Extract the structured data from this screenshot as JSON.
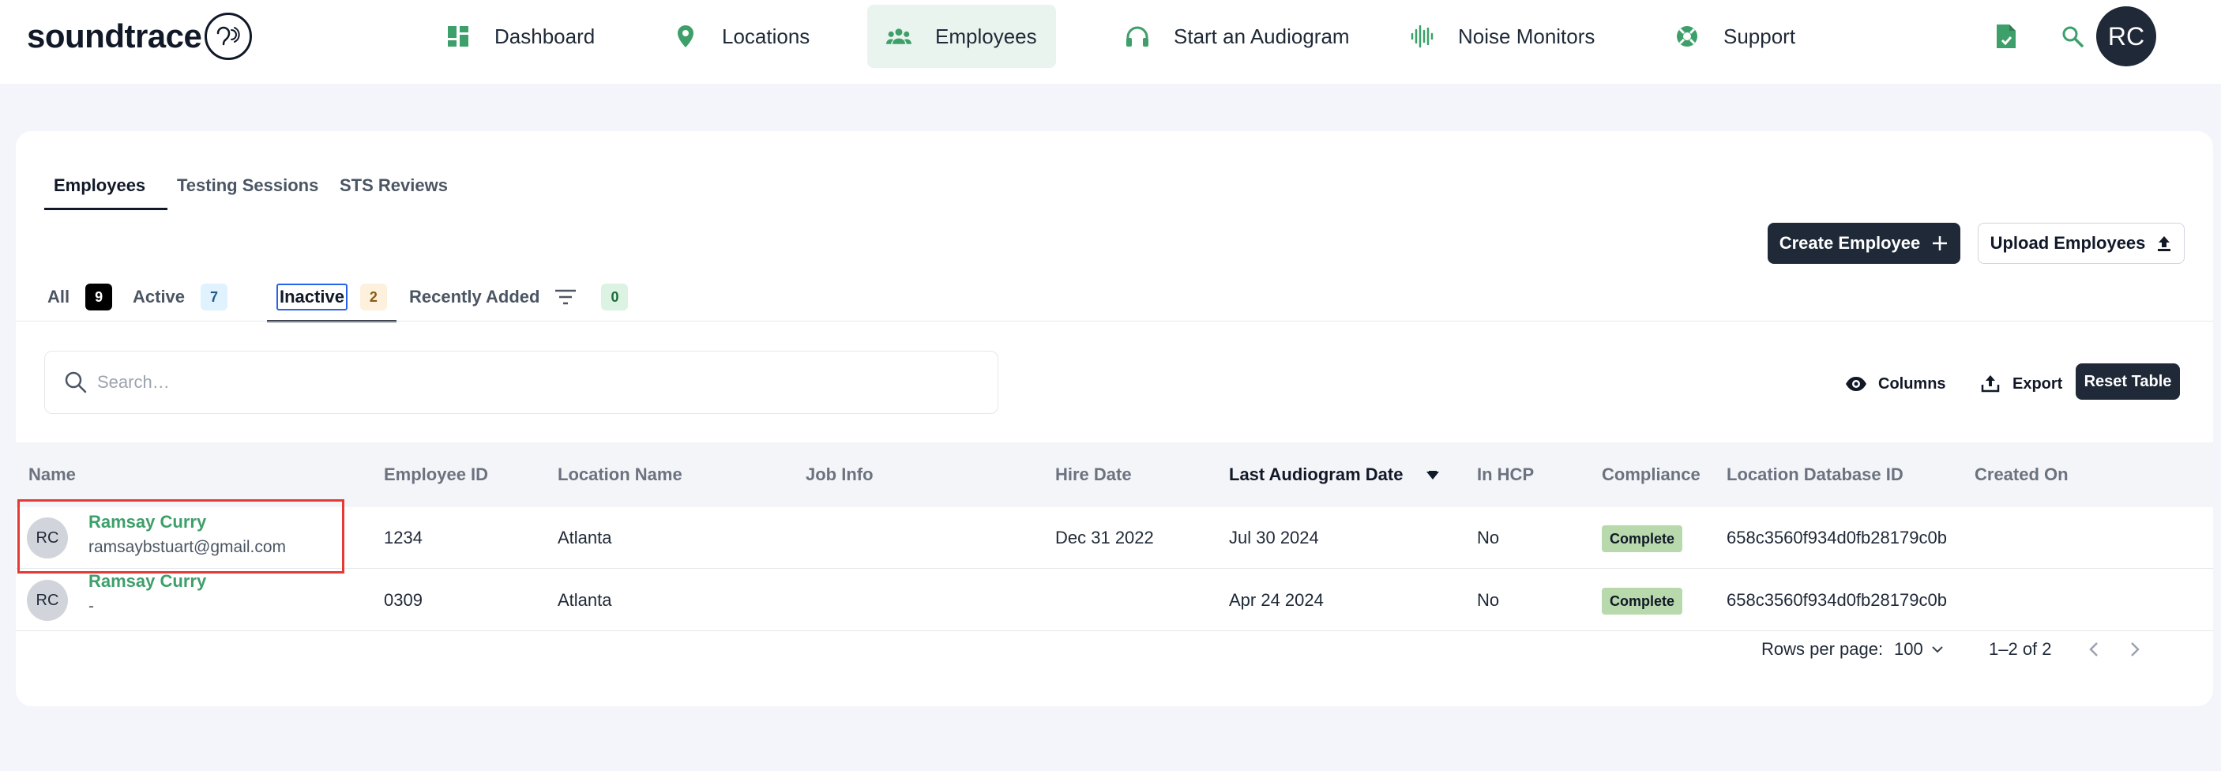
{
  "app": {
    "logo_text": "soundtrace"
  },
  "nav": {
    "items": [
      {
        "label": "Dashboard",
        "icon": "dashboard-icon"
      },
      {
        "label": "Locations",
        "icon": "location-pin-icon"
      },
      {
        "label": "Employees",
        "icon": "people-icon",
        "active": true
      },
      {
        "label": "Start an Audiogram",
        "icon": "headphones-icon"
      },
      {
        "label": "Noise Monitors",
        "icon": "soundwave-icon"
      },
      {
        "label": "Support",
        "icon": "lifebuoy-icon"
      }
    ],
    "user_initials": "RC"
  },
  "tabs": [
    {
      "label": "Employees",
      "active": true
    },
    {
      "label": "Testing Sessions"
    },
    {
      "label": "STS Reviews"
    }
  ],
  "actions": {
    "create_label": "Create Employee",
    "upload_label": "Upload Employees"
  },
  "filters": [
    {
      "label": "All",
      "count": "9"
    },
    {
      "label": "Active",
      "count": "7"
    },
    {
      "label": "Inactive",
      "count": "2",
      "active": true
    },
    {
      "label": "Recently Added",
      "count": "0"
    }
  ],
  "search": {
    "placeholder": "Search…",
    "value": ""
  },
  "toolbar": {
    "columns_label": "Columns",
    "export_label": "Export",
    "reset_label": "Reset Table"
  },
  "table": {
    "columns": [
      "Name",
      "Employee ID",
      "Location Name",
      "Job Info",
      "Hire Date",
      "Last Audiogram Date",
      "In HCP",
      "Compliance",
      "Location Database ID",
      "Created On"
    ],
    "rows": [
      {
        "initials": "RC",
        "name": "Ramsay Curry",
        "email": "ramsaybstuart@gmail.com",
        "employee_id": "1234",
        "location": "Atlanta",
        "job_info": "",
        "hire_date": "Dec 31 2022",
        "last_audiogram": "Jul 30 2024",
        "in_hcp": "No",
        "compliance": "Complete",
        "location_db_id": "658c3560f934d0fb28179c0b",
        "created_on": ""
      },
      {
        "initials": "RC",
        "name": "Ramsay Curry",
        "email": "-",
        "employee_id": "0309",
        "location": "Atlanta",
        "job_info": "",
        "hire_date": "",
        "last_audiogram": "Apr 24 2024",
        "in_hcp": "No",
        "compliance": "Complete",
        "location_db_id": "658c3560f934d0fb28179c0b",
        "created_on": ""
      }
    ]
  },
  "pagination": {
    "rows_per_page_label": "Rows per page:",
    "rows_per_page": "100",
    "range": "1–2 of 2"
  },
  "colors": {
    "brand_green": "#3d9f6a",
    "dark": "#1f2937",
    "highlight": "#e53935"
  }
}
